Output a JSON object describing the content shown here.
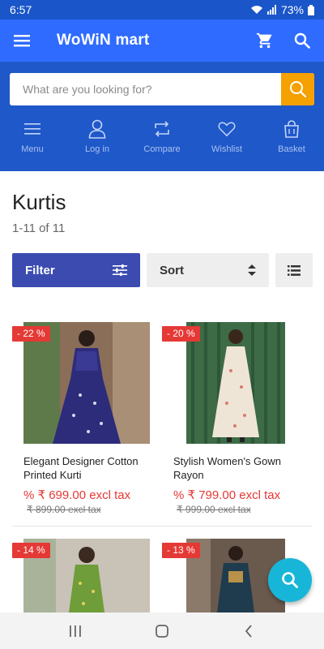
{
  "status_bar": {
    "time": "6:57",
    "battery": "73%"
  },
  "app_bar": {
    "title": "WoWiN mart"
  },
  "search": {
    "placeholder": "What are you looking for?"
  },
  "quick_nav": [
    {
      "label": "Menu",
      "icon": "menu-icon"
    },
    {
      "label": "Log in",
      "icon": "user-icon"
    },
    {
      "label": "Compare",
      "icon": "compare-icon"
    },
    {
      "label": "Wishlist",
      "icon": "heart-icon"
    },
    {
      "label": "Basket",
      "icon": "basket-icon"
    }
  ],
  "page": {
    "title": "Kurtis",
    "count": "1-11 of 11"
  },
  "controls": {
    "filter_label": "Filter",
    "sort_label": "Sort"
  },
  "products": [
    {
      "badge": "- 22 %",
      "name": "Elegant Designer Cotton Printed Kurti",
      "price": "% ₹ 699.00 excl tax",
      "old_price": "₹ 899.00 excl tax"
    },
    {
      "badge": "- 20 %",
      "name": "Stylish Women's Gown Rayon",
      "price": "% ₹ 799.00 excl tax",
      "old_price": "₹ 999.00 excl tax"
    },
    {
      "badge": "- 14 %",
      "name": "",
      "price": "",
      "old_price": ""
    },
    {
      "badge": "- 13 %",
      "name": "",
      "price": "",
      "old_price": ""
    }
  ],
  "colors": {
    "app_bar": "#2f6bff",
    "header_panel": "#1f58c9",
    "search_button": "#f5a102",
    "badge": "#e53935",
    "filter_button": "#3b4bb0",
    "fab": "#17b6d8"
  }
}
